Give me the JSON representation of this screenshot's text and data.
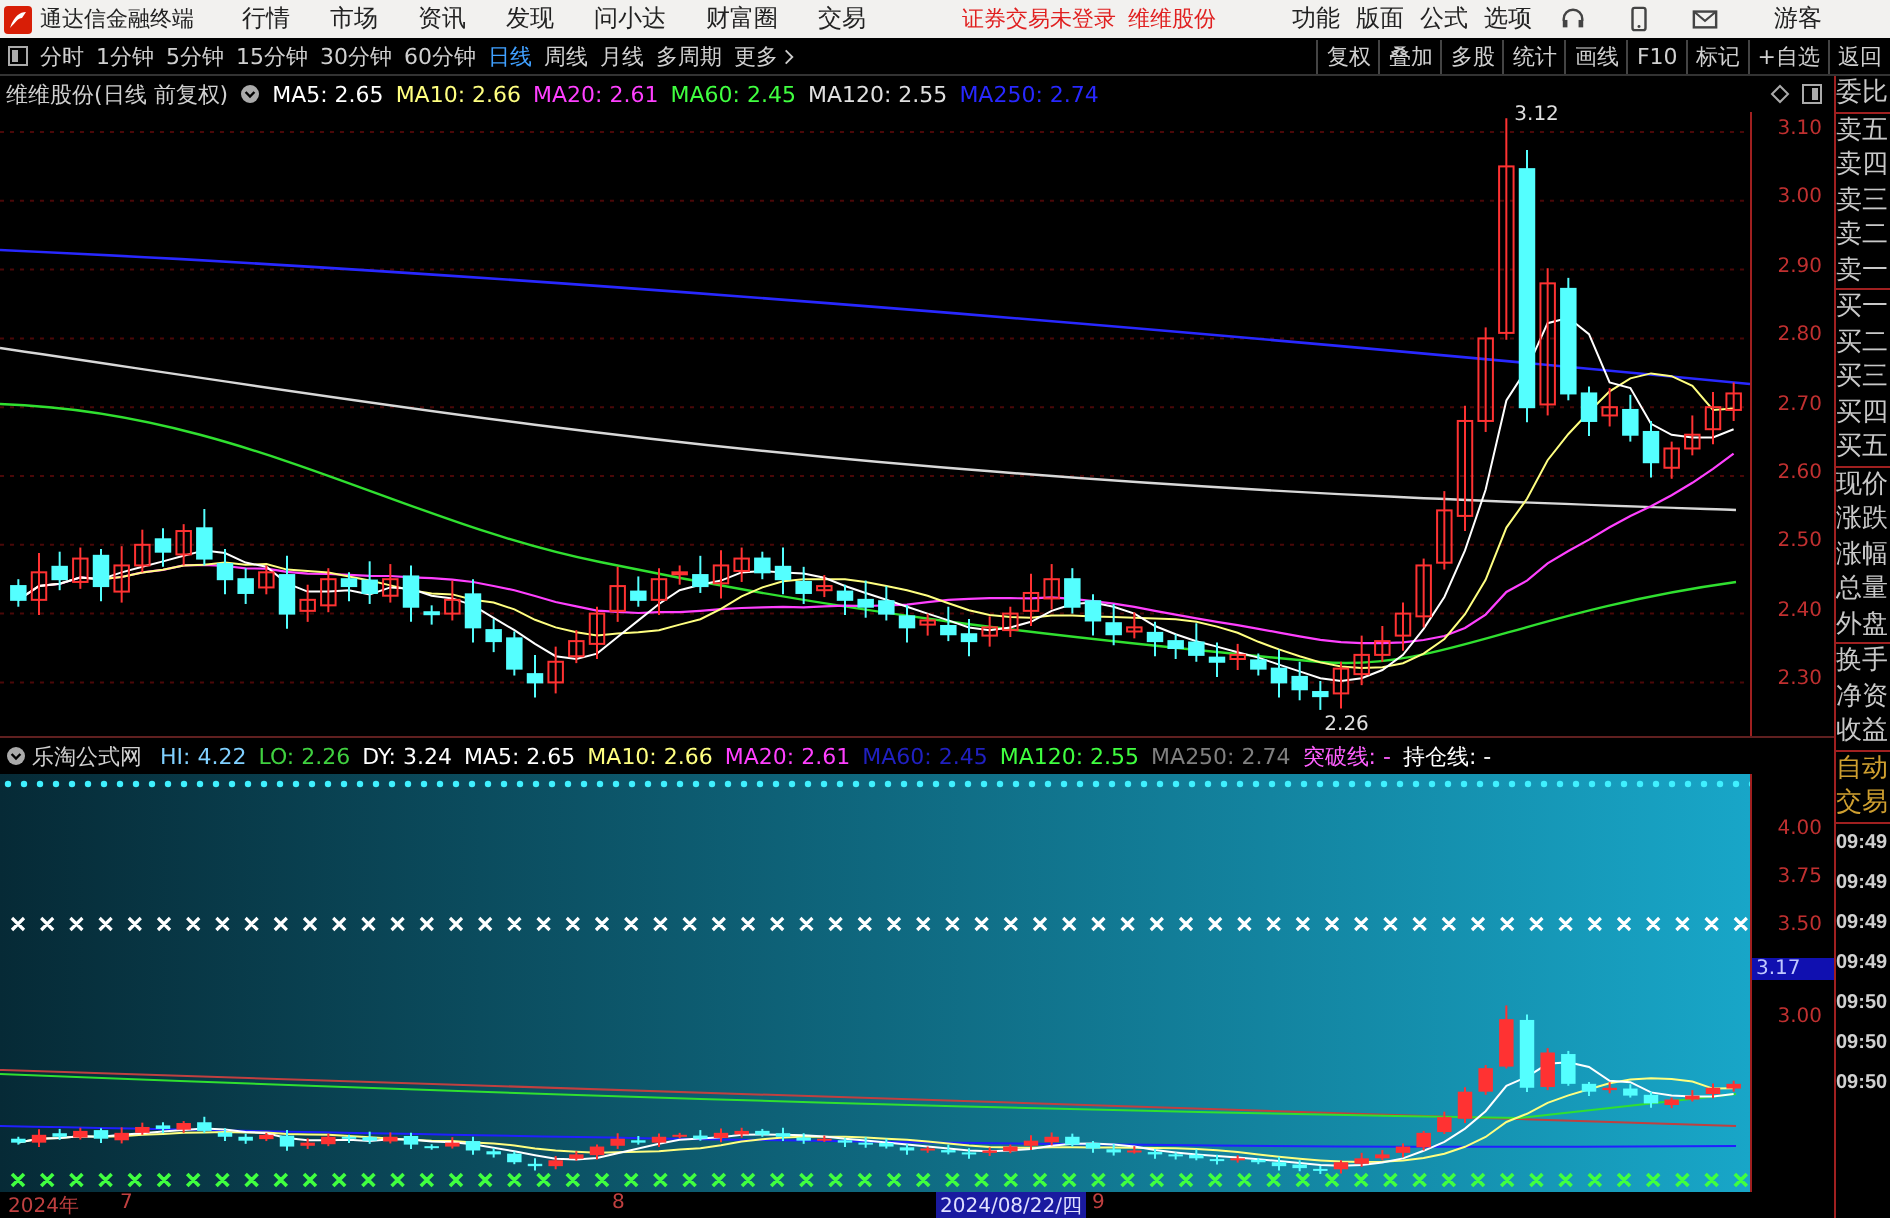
{
  "app": {
    "title": "通达信金融终端"
  },
  "menu": [
    "行情",
    "市场",
    "资讯",
    "发现",
    "问小达",
    "财富圈",
    "交易"
  ],
  "notices": [
    "证券交易未登录",
    "维维股份"
  ],
  "top_actions": [
    "功能",
    "版面",
    "公式",
    "选项"
  ],
  "user": "游客",
  "periods": [
    {
      "label": "分时",
      "selected": false
    },
    {
      "label": "1分钟",
      "selected": false
    },
    {
      "label": "5分钟",
      "selected": false
    },
    {
      "label": "15分钟",
      "selected": false
    },
    {
      "label": "30分钟",
      "selected": false
    },
    {
      "label": "60分钟",
      "selected": false
    },
    {
      "label": "日线",
      "selected": true
    },
    {
      "label": "周线",
      "selected": false
    },
    {
      "label": "月线",
      "selected": false
    },
    {
      "label": "多周期",
      "selected": false
    },
    {
      "label": "更多",
      "selected": false
    }
  ],
  "tools": [
    "复权",
    "叠加",
    "多股",
    "统计",
    "画线",
    "F10",
    "标记",
    "+自选",
    "返回"
  ],
  "main_chart": {
    "title": "维维股份(日线 前复权)",
    "indicators": [
      {
        "label": "MA5: 2.65",
        "color": "#ffffff"
      },
      {
        "label": "MA10: 2.66",
        "color": "#ffff80"
      },
      {
        "label": "MA20: 2.61",
        "color": "#ff40ff"
      },
      {
        "label": "MA60: 2.45",
        "color": "#40ff40"
      },
      {
        "label": "MA120: 2.55",
        "color": "#e0e0e0"
      },
      {
        "label": "MA250: 2.74",
        "color": "#2828ff"
      }
    ],
    "price_ticks": [
      "3.10",
      "3.00",
      "2.90",
      "2.80",
      "2.70",
      "2.60",
      "2.50",
      "2.40",
      "2.30"
    ],
    "high_label": "3.12",
    "low_label": "2.26"
  },
  "indicator_panel": {
    "name": "乐淘公式网",
    "values": [
      {
        "label": "HI: 4.22",
        "color": "#80d0ff"
      },
      {
        "label": "LO: 2.26",
        "color": "#40d040"
      },
      {
        "label": "DY: 3.24",
        "color": "#ffffff"
      },
      {
        "label": "MA5: 2.65",
        "color": "#ffffff"
      },
      {
        "label": "MA10: 2.66",
        "color": "#ffff80"
      },
      {
        "label": "MA20: 2.61",
        "color": "#ff40ff"
      },
      {
        "label": "MA60: 2.45",
        "color": "#2020c0"
      },
      {
        "label": "MA120: 2.55",
        "color": "#40ff40"
      },
      {
        "label": "MA250: 2.74",
        "color": "#808080"
      },
      {
        "label": "突破线: -",
        "color": "#ff60ff"
      },
      {
        "label": "持仓线: -",
        "color": "#ffffff"
      }
    ],
    "ticks": [
      {
        "label": "4.00",
        "selected": false
      },
      {
        "label": "3.75",
        "selected": false
      },
      {
        "label": "3.50",
        "selected": false
      },
      {
        "label": "3.17",
        "selected": true
      },
      {
        "label": "3.00",
        "selected": false
      }
    ]
  },
  "side_panel": {
    "groups": [
      [
        "委比"
      ],
      [
        "卖五",
        "卖四",
        "卖三",
        "卖二",
        "卖一"
      ],
      [
        "买一",
        "买二",
        "买三",
        "买四",
        "买五"
      ],
      [
        "现价",
        "涨跌",
        "涨幅",
        "总量",
        "外盘"
      ],
      [
        "换手",
        "净资",
        "收益"
      ]
    ],
    "trade_labels": [
      "自动",
      "交易"
    ],
    "times": [
      "09:49",
      "09:49",
      "09:49",
      "09:49",
      "09:50",
      "09:50",
      "09:50"
    ]
  },
  "time_axis": [
    {
      "label": "2024年",
      "selected": false
    },
    {
      "label": "7",
      "selected": false
    },
    {
      "label": "8",
      "selected": false
    },
    {
      "label": "2024/08/22/四",
      "selected": true
    },
    {
      "label": "9",
      "selected": false
    }
  ]
}
